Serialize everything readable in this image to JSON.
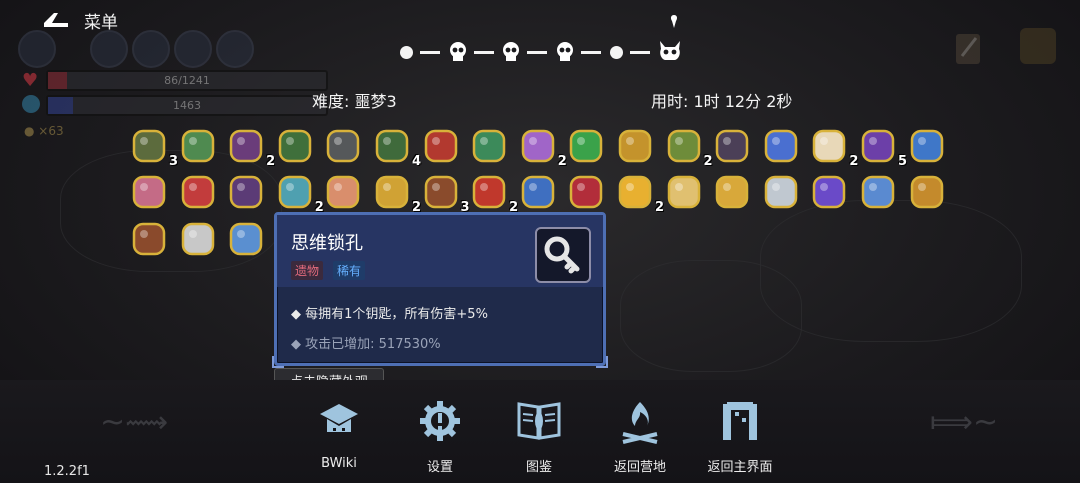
{
  "menu": {
    "label": "菜单"
  },
  "hud": {
    "hp_text": "86/1241",
    "shield_text": "1463",
    "coins": "×63"
  },
  "run": {
    "difficulty": "难度: 噩梦3",
    "time": "用时: 1时 12分 2秒"
  },
  "items": [
    {
      "name": "skull-mask",
      "count": "3",
      "color": "#5c6b3d"
    },
    {
      "name": "green-scroll",
      "count": "",
      "color": "#4f8a50"
    },
    {
      "name": "purple-cloak",
      "count": "2",
      "color": "#6a3c7a"
    },
    {
      "name": "green-boot",
      "count": "",
      "color": "#3f6f3b"
    },
    {
      "name": "stone-mask",
      "count": "",
      "color": "#55585a"
    },
    {
      "name": "green-trousers",
      "count": "4",
      "color": "#3f6a3b"
    },
    {
      "name": "red-wand",
      "count": "",
      "color": "#b2392f"
    },
    {
      "name": "green-ufo",
      "count": "",
      "color": "#3c8a5a"
    },
    {
      "name": "purple-crystal",
      "count": "2",
      "color": "#a065c8"
    },
    {
      "name": "green-crystal",
      "count": "",
      "color": "#3aa24a"
    },
    {
      "name": "gold-leaf",
      "count": "",
      "color": "#c4932c"
    },
    {
      "name": "green-branch",
      "count": "2",
      "color": "#6e8c3a"
    },
    {
      "name": "bat-wings",
      "count": "",
      "color": "#4b3f57"
    },
    {
      "name": "blue-potion",
      "count": "",
      "color": "#4a6fd0"
    },
    {
      "name": "white-feather",
      "count": "2",
      "color": "#e8d8b8"
    },
    {
      "name": "wizard-hat",
      "count": "5",
      "color": "#6c3fa8"
    },
    {
      "name": "blue-orb",
      "count": "",
      "color": "#3f77c8"
    },
    {
      "name": "brain",
      "count": "",
      "color": "#c46b86"
    },
    {
      "name": "red-amulet",
      "count": "",
      "color": "#c23c3c"
    },
    {
      "name": "purple-robe",
      "count": "",
      "color": "#5b3b76"
    },
    {
      "name": "gem-cube",
      "count": "2",
      "color": "#4fa0b0"
    },
    {
      "name": "pink-egg",
      "count": "",
      "color": "#d98e6c"
    },
    {
      "name": "gold-bell",
      "count": "2",
      "color": "#d0a234"
    },
    {
      "name": "fist",
      "count": "3",
      "color": "#8a4b2c"
    },
    {
      "name": "demon-head",
      "count": "2",
      "color": "#c0382c"
    },
    {
      "name": "blue-scope",
      "count": "",
      "color": "#3f6fc0"
    },
    {
      "name": "red-snake",
      "count": "",
      "color": "#b22d3a"
    },
    {
      "name": "candy-corn",
      "count": "2",
      "color": "#e8b030"
    },
    {
      "name": "bee-wings",
      "count": "",
      "color": "#e0c070"
    },
    {
      "name": "gold-crown-leaves",
      "count": "",
      "color": "#d8a83a"
    },
    {
      "name": "hook-arrow",
      "count": "",
      "color": "#c0c8d0"
    },
    {
      "name": "purple-boot",
      "count": "",
      "color": "#6a4ac8"
    },
    {
      "name": "blue-hook",
      "count": "",
      "color": "#5a8ad0"
    },
    {
      "name": "gold-map",
      "count": "",
      "color": "#c48a2c"
    },
    {
      "name": "wood-crate",
      "count": "",
      "color": "#8a4a2c"
    },
    {
      "name": "silver-key",
      "count": "",
      "color": "#c8c8c8"
    },
    {
      "name": "magnifier",
      "count": "",
      "color": "#5a8fd0"
    }
  ],
  "tooltip": {
    "title": "思维锁孔",
    "badge_type": "遗物",
    "badge_rarity": "稀有",
    "line1": "每拥有1个钥匙，所有伤害+5%",
    "line2": "攻击已增加: 517530%"
  },
  "hide_button": "点击隐藏外观",
  "nav": [
    {
      "label": "BWiki",
      "icon": "graduation-cap-icon"
    },
    {
      "label": "设置",
      "icon": "gear-icon"
    },
    {
      "label": "图鉴",
      "icon": "book-icon"
    },
    {
      "label": "返回营地",
      "icon": "campfire-icon"
    },
    {
      "label": "返回主界面",
      "icon": "gate-icon"
    }
  ],
  "version": "1.2.2f1"
}
